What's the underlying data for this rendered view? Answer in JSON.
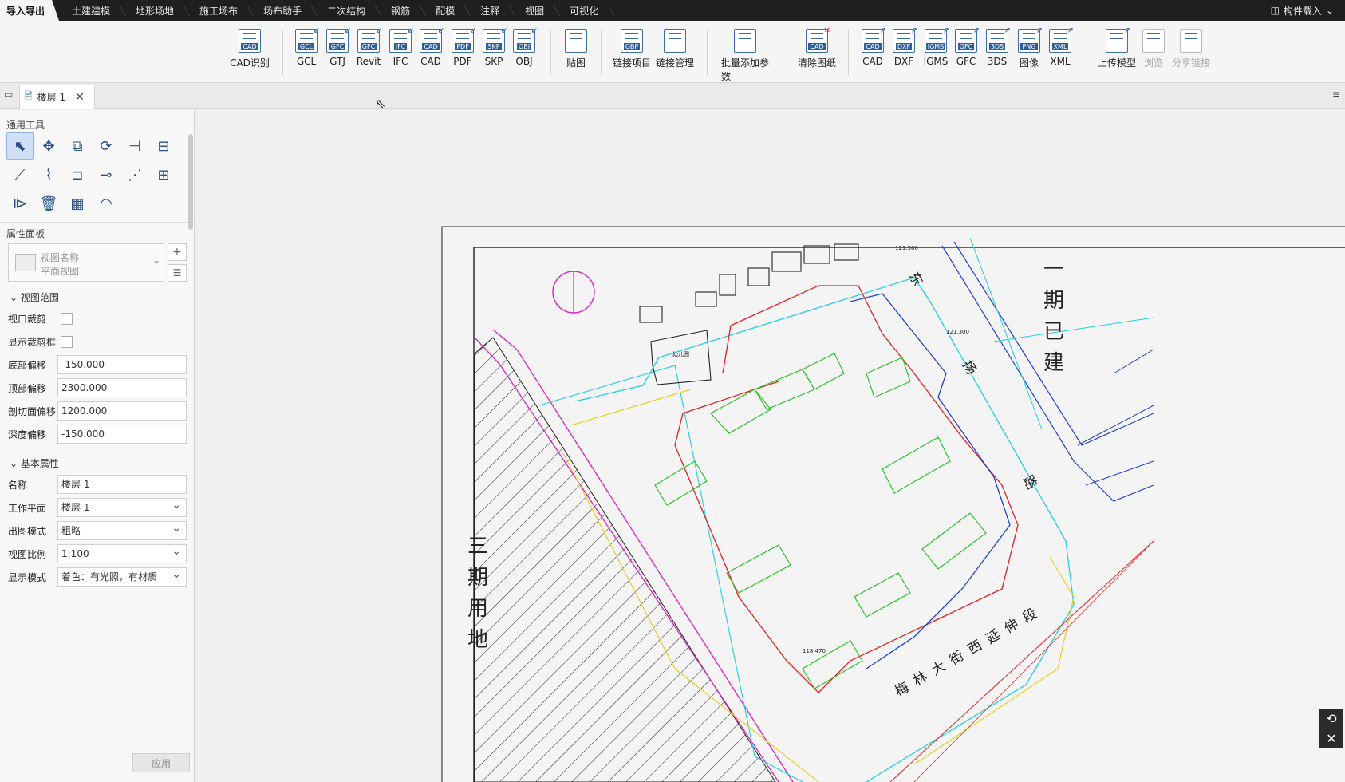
{
  "menubar": {
    "tabs": [
      "导入导出",
      "土建建模",
      "地形场地",
      "施工场布",
      "场布助手",
      "二次结构",
      "钢筋",
      "配模",
      "注释",
      "视图",
      "可视化"
    ],
    "right_label": "构件载入"
  },
  "ribbon": {
    "buttons": [
      {
        "label": "CAD识别",
        "tag": "CAD"
      },
      {
        "label": "GCL",
        "tag": "GCL"
      },
      {
        "label": "GTJ",
        "tag": "GFC"
      },
      {
        "label": "Revit",
        "tag": "GFC"
      },
      {
        "label": "IFC",
        "tag": "IFC"
      },
      {
        "label": "CAD",
        "tag": "CAD"
      },
      {
        "label": "PDF",
        "tag": "PDF"
      },
      {
        "label": "SKP",
        "tag": "SKP"
      },
      {
        "label": "OBJ",
        "tag": "OBJ"
      },
      {
        "label": "贴图",
        "tag": ""
      },
      {
        "label": "链接项目",
        "tag": "GBP"
      },
      {
        "label": "链接管理",
        "tag": ""
      },
      {
        "label": "批量添加参数",
        "tag": ""
      },
      {
        "label": "清除图纸",
        "tag": "CAD"
      },
      {
        "label": "CAD",
        "tag": "CAD"
      },
      {
        "label": "DXF",
        "tag": "DXF"
      },
      {
        "label": "IGMS",
        "tag": "IGMS"
      },
      {
        "label": "GFC",
        "tag": "GFC"
      },
      {
        "label": "3DS",
        "tag": "3DS"
      },
      {
        "label": "图像",
        "tag": "PNG"
      },
      {
        "label": "XML",
        "tag": "XML"
      },
      {
        "label": "上传模型",
        "tag": ""
      },
      {
        "label": "浏览",
        "tag": ""
      },
      {
        "label": "分享链接",
        "tag": ""
      }
    ]
  },
  "doc_tab": {
    "label": "楼层 1"
  },
  "left": {
    "tools_title": "通用工具",
    "props_title": "属性面板",
    "view_name_line1": "视图名称",
    "view_name_line2": "平面视图",
    "group_view_range": "视图范围",
    "group_basic": "基本属性",
    "view_range": [
      {
        "label": "视口裁剪",
        "type": "check"
      },
      {
        "label": "显示裁剪框",
        "type": "check"
      },
      {
        "label": "底部偏移",
        "value": "-150.000"
      },
      {
        "label": "顶部偏移",
        "value": "2300.000"
      },
      {
        "label": "剖切面偏移",
        "value": "1200.000"
      },
      {
        "label": "深度偏移",
        "value": "-150.000"
      }
    ],
    "basic": [
      {
        "label": "名称",
        "value": "楼层 1",
        "select": false
      },
      {
        "label": "工作平面",
        "value": "楼层 1",
        "select": true
      },
      {
        "label": "出图模式",
        "value": "粗略",
        "select": true
      },
      {
        "label": "视图比例",
        "value": "1:100",
        "select": true
      },
      {
        "label": "显示模式",
        "value": "着色：有光照，有材质",
        "select": true
      }
    ],
    "apply_label": "应用"
  },
  "drawing": {
    "label_phase1": [
      "一",
      "期",
      "已",
      "建"
    ],
    "label_phase3": [
      "三",
      "期",
      "用",
      "地"
    ],
    "road_south": "梅 林 大 街 西 延 伸 段",
    "kindergarten": "幼儿园",
    "road_east_chars": [
      "东",
      "扬",
      "路"
    ],
    "elev_1": "121.500",
    "elev_2": "121.300",
    "elev_3": "118.470"
  },
  "colors": {
    "menubar": "#1f1f1f",
    "ribbon": "#f5f5f5",
    "accent": "#2b5f9c",
    "canvas": "#f0f0f0"
  }
}
